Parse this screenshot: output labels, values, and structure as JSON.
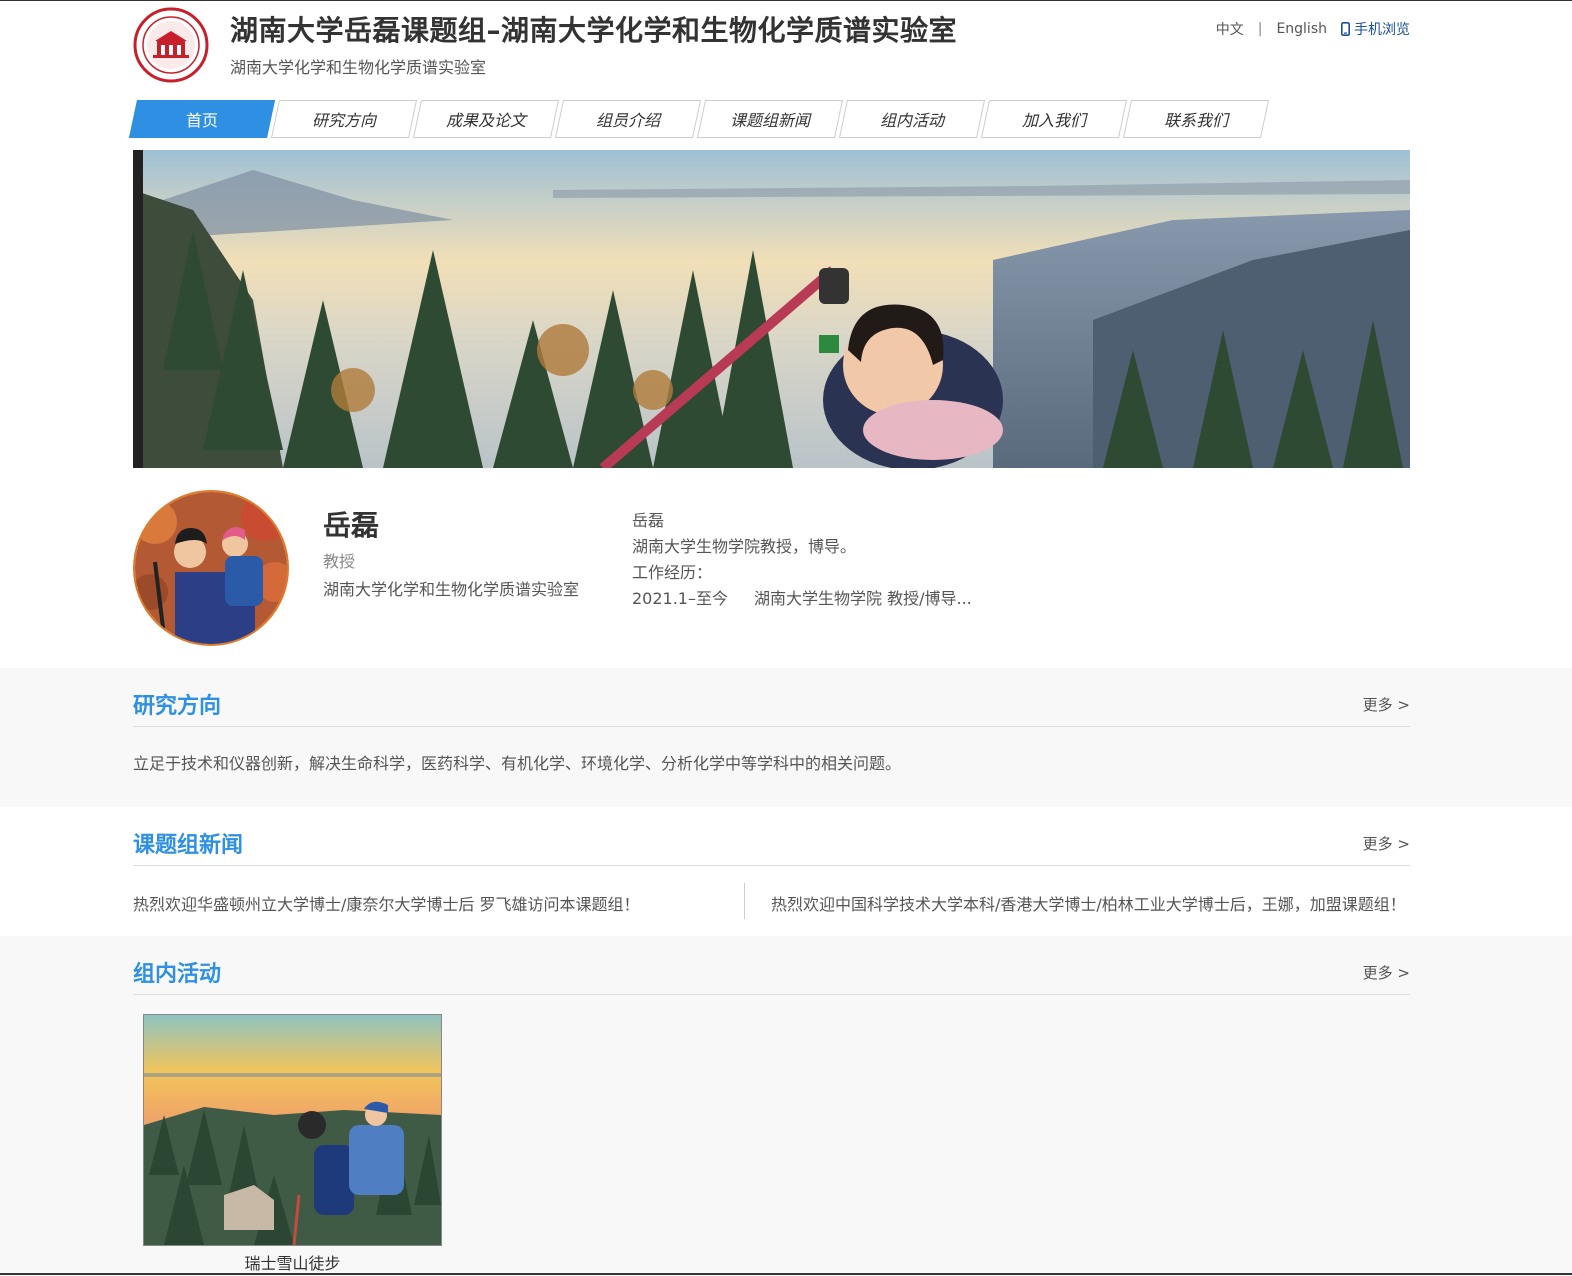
{
  "header": {
    "title": "湖南大学岳磊课题组–湖南大学化学和生物化学质谱实验室",
    "subtitle": "湖南大学化学和生物化学质谱实验室",
    "lang_zh": "中文",
    "lang_sep": "|",
    "lang_en": "English",
    "mobile": "手机浏览"
  },
  "nav": {
    "items": [
      {
        "label": "首页"
      },
      {
        "label": "研究方向"
      },
      {
        "label": "成果及论文"
      },
      {
        "label": "组员介绍"
      },
      {
        "label": "课题组新闻"
      },
      {
        "label": "组内活动"
      },
      {
        "label": "加入我们"
      },
      {
        "label": "联系我们"
      }
    ],
    "active_index": 0
  },
  "profile": {
    "name": "岳磊",
    "title": "教授",
    "lab": "湖南大学化学和生物化学质谱实验室",
    "intro": {
      "line1": "岳磊",
      "line2": "湖南大学生物学院教授，博导。",
      "line3": "工作经历：",
      "line4_date": "2021.1–至今",
      "line4_text": "湖南大学生物学院  教授/博导..."
    }
  },
  "research": {
    "title": "研究方向",
    "more": "更多 >",
    "text": "立足于技术和仪器创新，解决生命科学，医药科学、有机化学、环境化学、分析化学中等学科中的相关问题。"
  },
  "news": {
    "title": "课题组新闻",
    "more": "更多 >",
    "items": [
      "热烈欢迎华盛顿州立大学博士/康奈尔大学博士后 罗飞雄访问本课题组！",
      "热烈欢迎中国科学技术大学本科/香港大学博士/柏林工业大学博士后，王娜，加盟课题组！"
    ]
  },
  "activities": {
    "title": "组内活动",
    "more": "更多 >",
    "items": [
      {
        "caption": "瑞士雪山徒步"
      }
    ]
  },
  "colors": {
    "accent": "#2f90e3",
    "avatar_border": "#e07a28",
    "mobile_link": "#1a4f9c"
  }
}
